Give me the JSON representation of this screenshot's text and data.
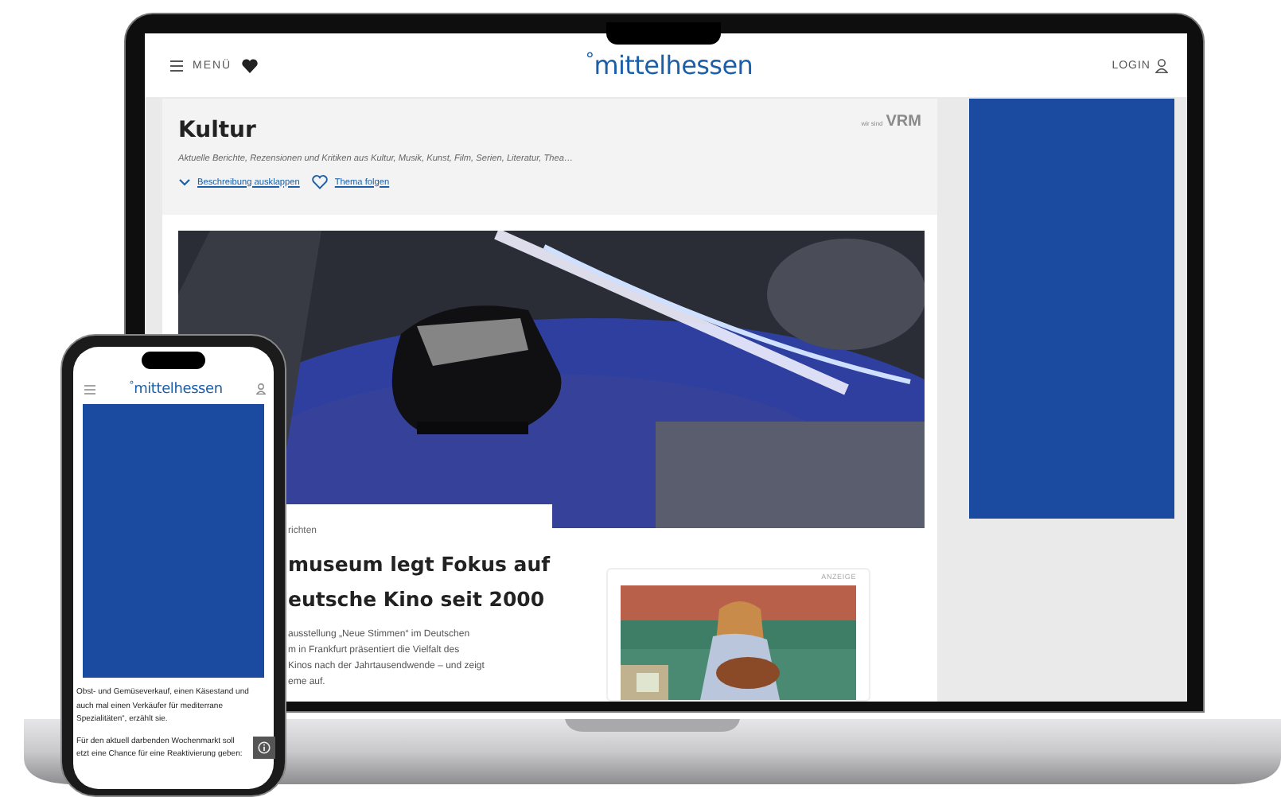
{
  "laptop": {
    "header": {
      "menu_label": "MENÜ",
      "logo_mark": "°",
      "logo": "mittelhessen",
      "login_label": "LOGIN"
    },
    "topic": {
      "title": "Kultur",
      "publisher_prefix": "wir sind",
      "publisher": "VRM",
      "description": "Aktuelle Berichte, Rezensionen und Kritiken aus Kultur, Musik, Kunst, Film, Serien, Literatur, Thea…",
      "actions": [
        {
          "kind": "expand",
          "label": "Beschreibung ausklappen"
        },
        {
          "kind": "follow",
          "label": "Thema folgen"
        }
      ]
    },
    "article": {
      "kicker": "richten",
      "headline_lines": [
        "museum legt Fokus auf",
        "eutsche Kino seit 2000"
      ],
      "teaser_lines": [
        "ausstellung „Neue Stimmen“ im Deutschen",
        "m in Frankfurt präsentiert die Vielfalt des",
        "Kinos nach der Jahrtausendwende – und zeigt",
        "eme auf."
      ]
    },
    "ad": {
      "label": "ANZEIGE"
    }
  },
  "phone": {
    "header": {
      "logo_mark": "°",
      "logo": "mittelhessen"
    },
    "paragraphs": [
      [
        "Obst- und Gemüseverkauf, einen Käsestand und",
        "auch mal einen Verkäufer für mediterrane",
        "Spezialitäten“, erzählt sie."
      ],
      [
        "Für den aktuell darbenden Wochenmarkt soll",
        "etzt eine Chance für eine Reaktivierung geben:"
      ]
    ]
  }
}
